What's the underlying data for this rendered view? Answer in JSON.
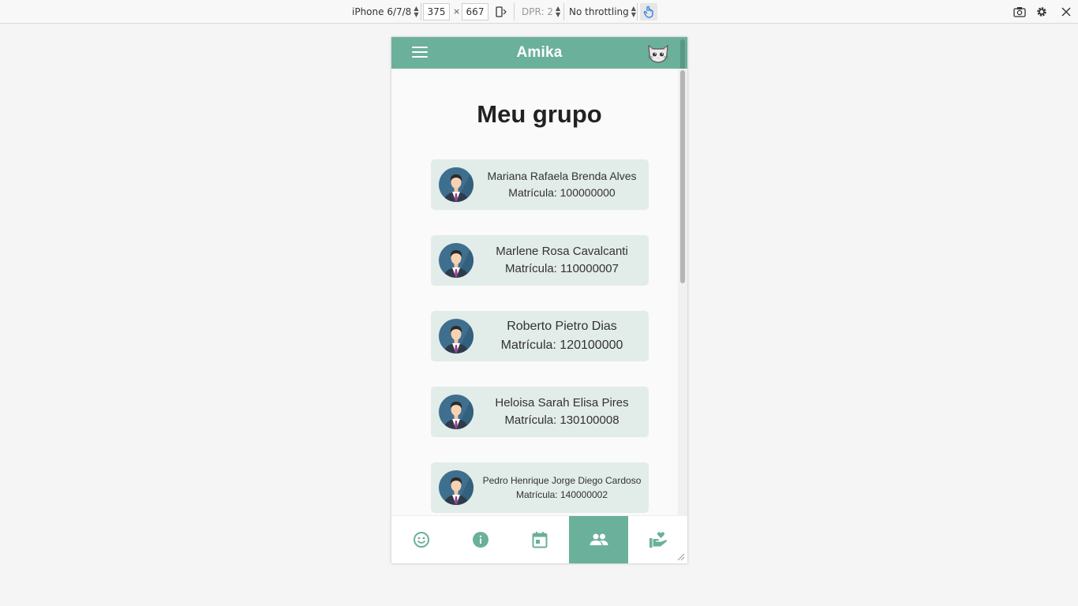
{
  "devtools": {
    "device": "iPhone 6/7/8",
    "width": "375",
    "height": "667",
    "dimension_separator": "×",
    "dpr": "DPR: 2",
    "throttling": "No throttling"
  },
  "app": {
    "title": "Amika",
    "accent_color": "#6ab09b",
    "card_color": "#e2ece9"
  },
  "page": {
    "title": "Meu grupo"
  },
  "members": [
    {
      "name": "Mariana Rafaela Brenda Alves",
      "id": "Matrícula: 100000000"
    },
    {
      "name": "Marlene Rosa Cavalcanti",
      "id": "Matrícula: 110000007"
    },
    {
      "name": "Roberto Pietro Dias",
      "id": "Matrícula: 120100000"
    },
    {
      "name": "Heloisa Sarah Elisa Pires",
      "id": "Matrícula: 130100008"
    },
    {
      "name": "Pedro Henrique Jorge Diego Cardoso",
      "id": "Matrícula: 140000002"
    }
  ],
  "bottom_nav": [
    {
      "icon": "smiley-icon",
      "active": false
    },
    {
      "icon": "info-icon",
      "active": false
    },
    {
      "icon": "calendar-icon",
      "active": false
    },
    {
      "icon": "group-icon",
      "active": true
    },
    {
      "icon": "care-hand-heart-icon",
      "active": false
    }
  ]
}
